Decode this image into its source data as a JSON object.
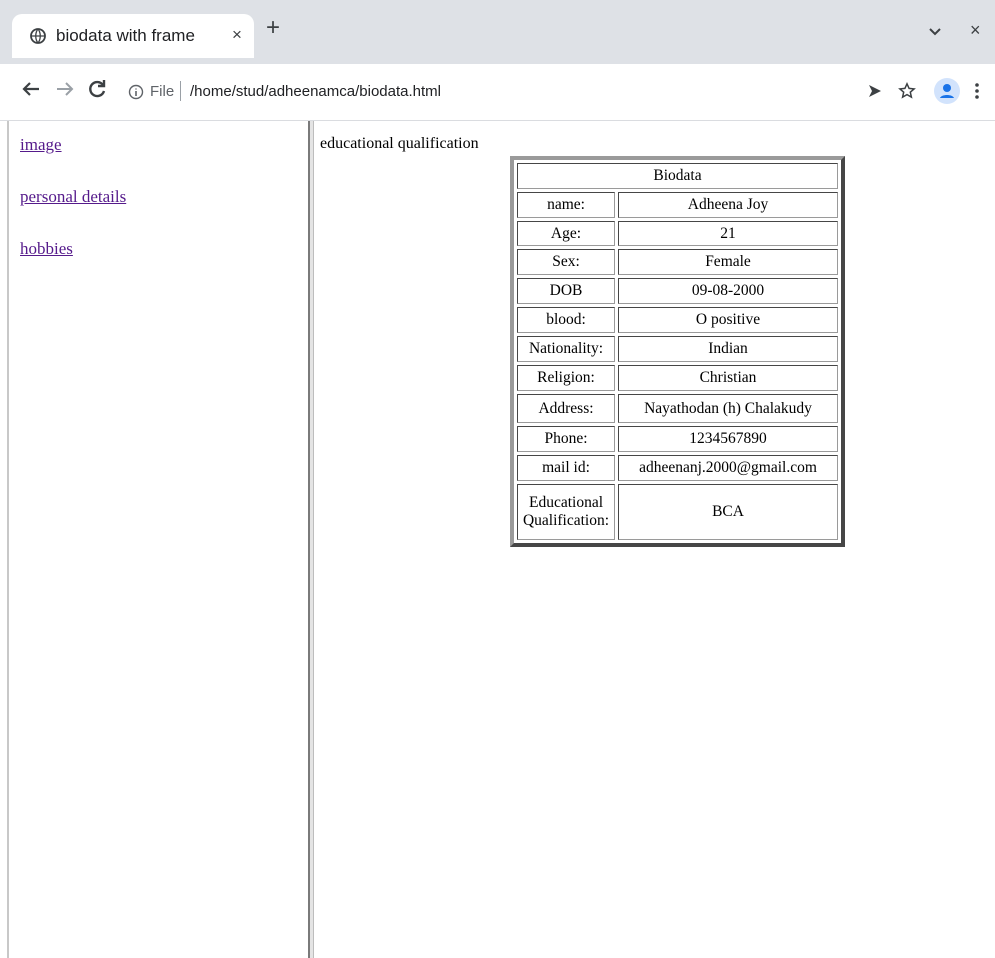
{
  "browser": {
    "tab_title": "biodata with frame",
    "tab_close": "×",
    "new_tab": "+",
    "window_close": "×",
    "omnibox_file": "File",
    "url": "/home/stud/adheenamca/biodata.html",
    "icons": [
      "globe-icon",
      "chevron-down-icon",
      "back-arrow-icon",
      "forward-arrow-icon",
      "reload-icon",
      "info-icon",
      "send-icon",
      "star-icon",
      "profile-icon",
      "more-vert-icon"
    ]
  },
  "nav_frame": {
    "links": [
      "image",
      "personal details",
      "hobbies"
    ],
    "link_color": "#551a8b"
  },
  "content_frame": {
    "heading": "educational qualification",
    "table": {
      "title": "Biodata",
      "rows": [
        {
          "label": "name:",
          "value": "Adheena Joy"
        },
        {
          "label": "Age:",
          "value": "21"
        },
        {
          "label": "Sex:",
          "value": "Female"
        },
        {
          "label": "DOB",
          "value": "09-08-2000"
        },
        {
          "label": "blood:",
          "value": "O positive"
        },
        {
          "label": "Nationality:",
          "value": "Indian"
        },
        {
          "label": "Religion:",
          "value": "Christian"
        },
        {
          "label": "Address:",
          "value": "Nayathodan (h) Chalakudy"
        },
        {
          "label": "Phone:",
          "value": "1234567890"
        },
        {
          "label": "mail id:",
          "value": "adheenanj.2000@gmail.com"
        },
        {
          "label": "Educational Qualification:",
          "value": "BCA"
        }
      ]
    }
  }
}
